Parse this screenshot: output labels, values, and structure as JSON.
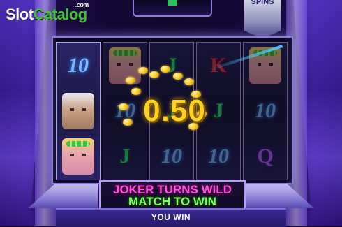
{
  "watermark": {
    "part1": "Slot",
    "part2": "Catalog",
    "suffix": ".com"
  },
  "spins_tab": {
    "label": "SPINS"
  },
  "reels": [
    {
      "symbols": [
        "10",
        "king",
        "queen"
      ],
      "dimmed": false
    },
    {
      "symbols": [
        "queen",
        "10",
        "J"
      ],
      "dimmed": true
    },
    {
      "symbols": [
        "J",
        "J",
        "10"
      ],
      "dimmed": true
    },
    {
      "symbols": [
        "K",
        "J",
        "10"
      ],
      "dimmed": true
    },
    {
      "symbols": [
        "queen",
        "10",
        "Q"
      ],
      "dimmed": true
    }
  ],
  "win_display": {
    "amount": "0.50"
  },
  "banner": {
    "line1": "JOKER TURNS WILD",
    "line2": "MATCH TO WIN"
  },
  "bottom_bar": {
    "label": "YOU WIN"
  },
  "colors": {
    "background": "#1a0c3a",
    "win_amount": "#ffd21a",
    "banner_line1": "#ff4fd8",
    "banner_line2": "#7dff5e",
    "logo_slot": "#ffffff",
    "logo_catalog": "#3fc23a"
  }
}
